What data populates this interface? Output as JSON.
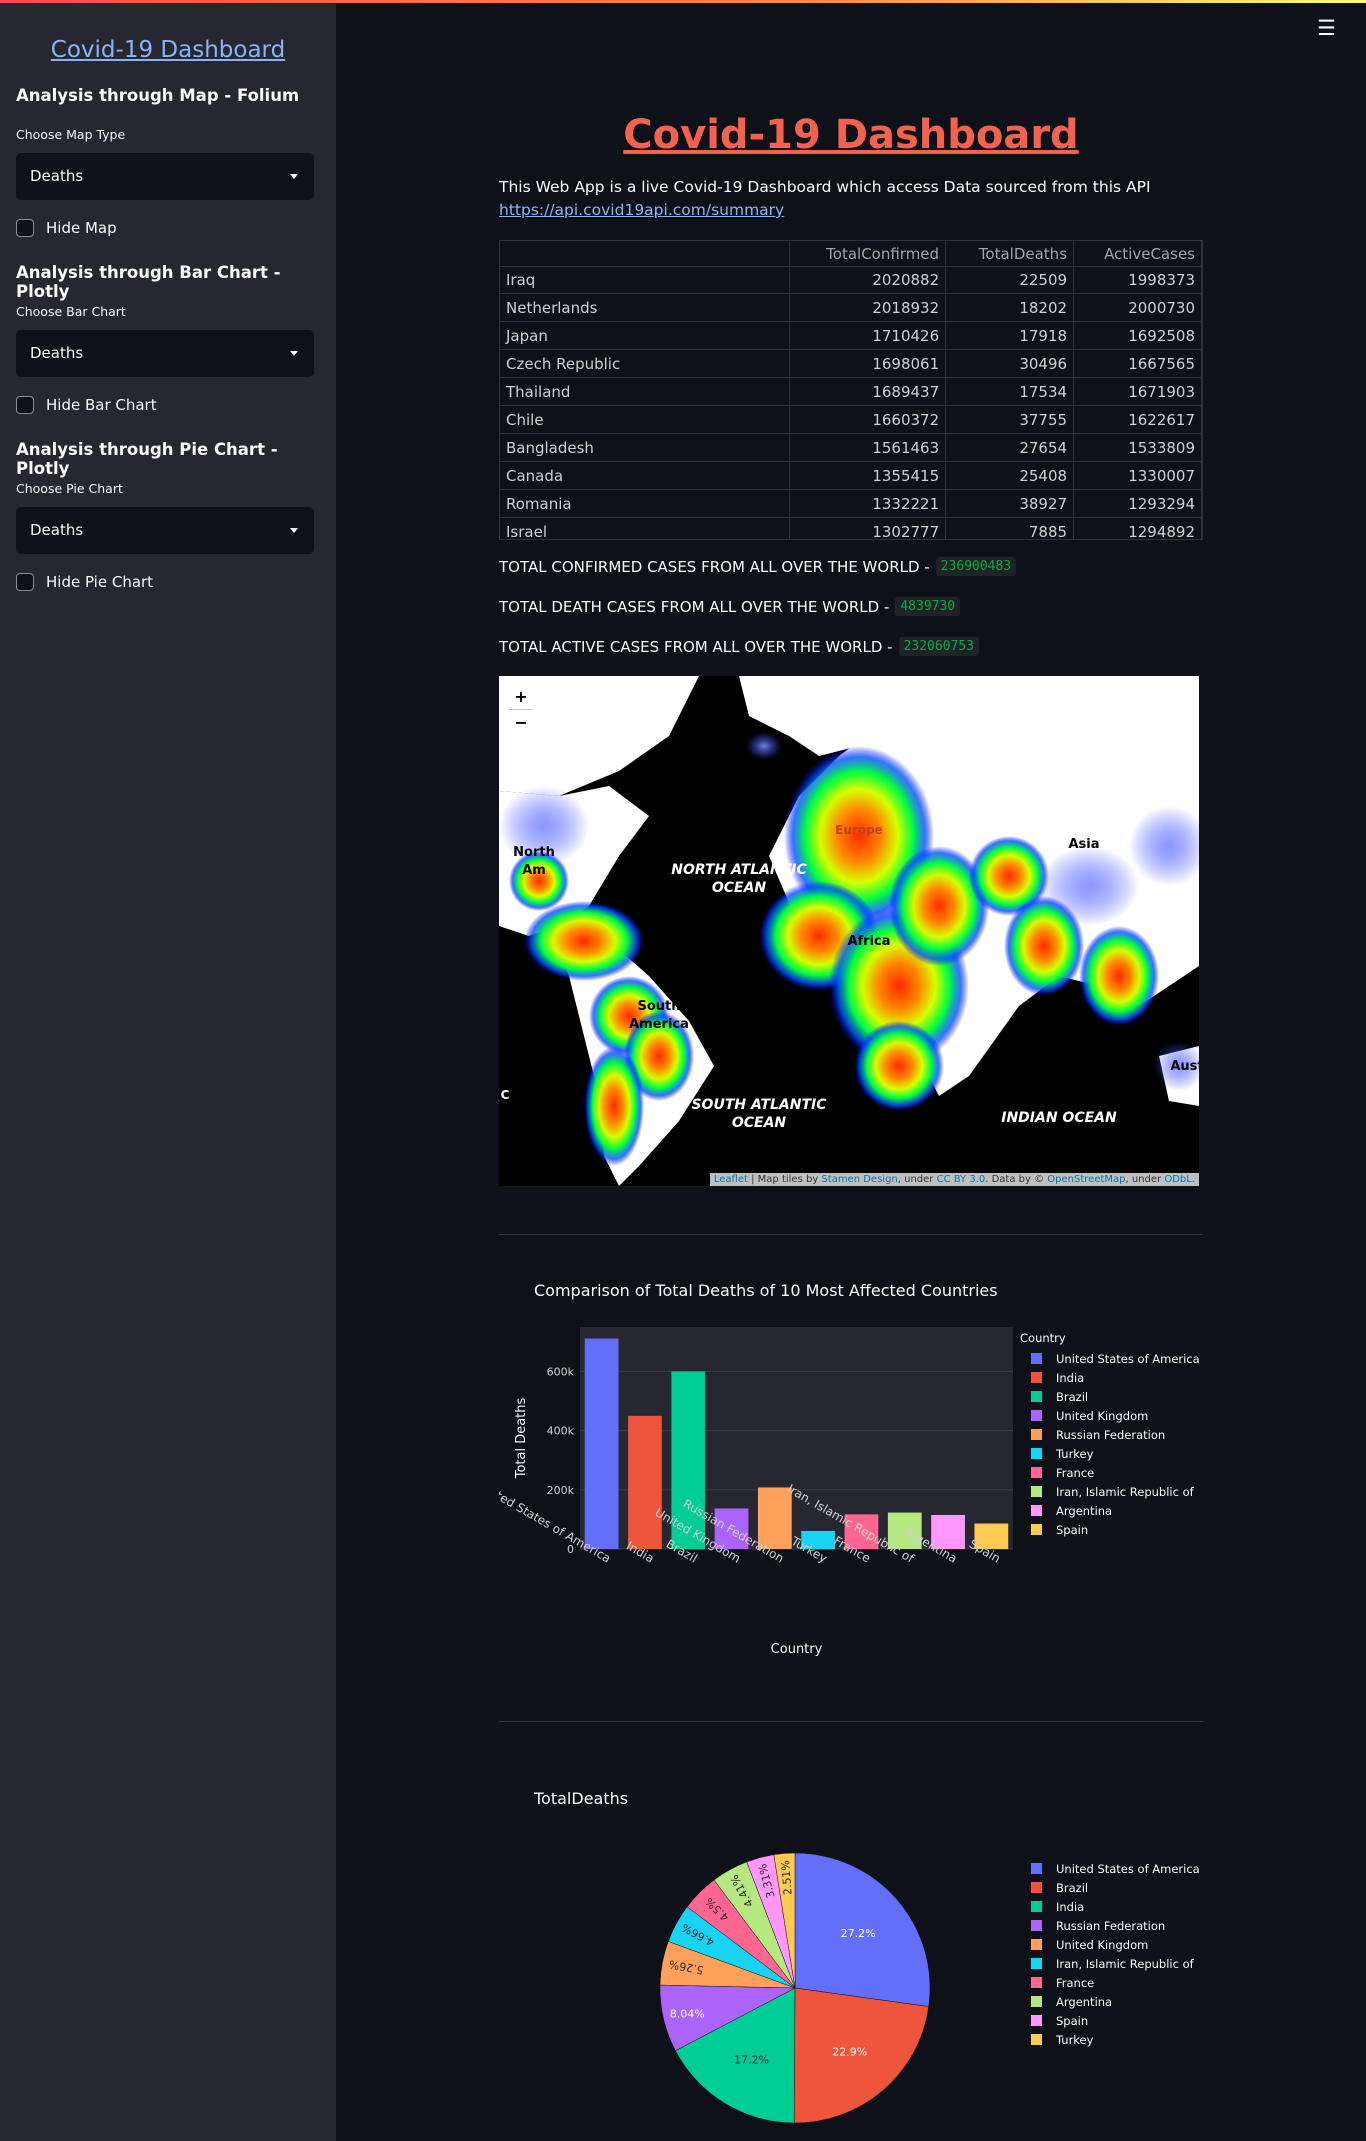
{
  "app": {
    "menu_icon": "hamburger-icon"
  },
  "sidebar": {
    "title": "Covid-19 Dashboard",
    "map_section": {
      "heading": "Analysis through Map - Folium",
      "label": "Choose Map Type",
      "value": "Deaths",
      "hide_label": "Hide Map"
    },
    "bar_section": {
      "heading": "Analysis through Bar Chart - Plotly",
      "label": "Choose Bar Chart",
      "value": "Deaths",
      "hide_label": "Hide Bar Chart"
    },
    "pie_section": {
      "heading": "Analysis through Pie Chart - Plotly",
      "label": "Choose Pie Chart",
      "value": "Deaths",
      "hide_label": "Hide Pie Chart"
    }
  },
  "main": {
    "title": "Covid-19 Dashboard",
    "intro": "This Web App is a live Covid-19 Dashboard which access Data sourced from this API",
    "api_link": "https://api.covid19api.com/summary"
  },
  "table": {
    "columns": [
      "",
      "TotalConfirmed",
      "TotalDeaths",
      "ActiveCases"
    ],
    "rows": [
      [
        "Iraq",
        "2020882",
        "22509",
        "1998373"
      ],
      [
        "Netherlands",
        "2018932",
        "18202",
        "2000730"
      ],
      [
        "Japan",
        "1710426",
        "17918",
        "1692508"
      ],
      [
        "Czech Republic",
        "1698061",
        "30496",
        "1667565"
      ],
      [
        "Thailand",
        "1689437",
        "17534",
        "1671903"
      ],
      [
        "Chile",
        "1660372",
        "37755",
        "1622617"
      ],
      [
        "Bangladesh",
        "1561463",
        "27654",
        "1533809"
      ],
      [
        "Canada",
        "1355415",
        "25408",
        "1330007"
      ],
      [
        "Romania",
        "1332221",
        "38927",
        "1293294"
      ],
      [
        "Israel",
        "1302777",
        "7885",
        "1294892"
      ]
    ]
  },
  "totals": {
    "confirmed_label": "TOTAL CONFIRMED CASES FROM ALL OVER THE WORLD -",
    "confirmed_value": "236900483",
    "deaths_label": "TOTAL DEATH CASES FROM ALL OVER THE WORLD -",
    "deaths_value": "4839730",
    "active_label": "TOTAL ACTIVE CASES FROM ALL OVER THE WORLD -",
    "active_value": "232060753"
  },
  "map": {
    "zoom_in": "+",
    "zoom_out": "−",
    "labels": {
      "north_atlantic": "NORTH ATLANTIC\nOCEAN",
      "south_atlantic": "SOUTH ATLANTIC\nOCEAN",
      "indian": "INDIAN OCEAN",
      "north_america": "North\nAm",
      "south_america": "South\nAmerica",
      "africa": "Africa",
      "asia": "Asia",
      "europe": "Europe",
      "australia": "Aust",
      "edge_c": "C"
    },
    "attribution": {
      "leaflet": "Leaflet",
      "t1": " | Map tiles by ",
      "stamen": "Stamen Design",
      "t2": ", under ",
      "ccby": "CC BY 3.0",
      "t3": ". Data by © ",
      "osm": "OpenStreetMap",
      "t4": ", under ",
      "odbl": "ODbL."
    },
    "heat_colors": [
      "#ff0000",
      "#ffff00",
      "#00ff00",
      "#0000ff"
    ]
  },
  "chart_data": [
    {
      "type": "bar",
      "title": "Comparison of Total Deaths of 10 Most Affected Countries",
      "xlabel": "Country",
      "ylabel": "Total Deaths",
      "legend_title": "Country",
      "legend_position": "right",
      "categories": [
        "United States of America",
        "India",
        "Brazil",
        "United Kingdom",
        "Russian Federation",
        "Turkey",
        "France",
        "Iran, Islamic Republic of",
        "Argentina",
        "Spain"
      ],
      "values": [
        711000,
        450000,
        600000,
        137000,
        208000,
        61000,
        117000,
        123000,
        115000,
        86000
      ],
      "colors": [
        "#636efa",
        "#ef553b",
        "#00cc96",
        "#ab63fa",
        "#ffa15a",
        "#19d3f3",
        "#ff6692",
        "#b6e880",
        "#ff97ff",
        "#fecb52"
      ],
      "yticks": [
        0,
        200000,
        400000,
        600000
      ],
      "ytick_labels": [
        "0",
        "200k",
        "400k",
        "600k"
      ],
      "ylim": [
        0,
        750000
      ],
      "grid": true
    },
    {
      "type": "pie",
      "title": "TotalDeaths",
      "legend_position": "right",
      "labels": [
        "United States of America",
        "Brazil",
        "India",
        "Russian Federation",
        "United Kingdom",
        "Iran, Islamic Republic of",
        "France",
        "Argentina",
        "Spain",
        "Turkey"
      ],
      "values": [
        27.2,
        22.9,
        17.2,
        8.04,
        5.26,
        4.66,
        4.5,
        4.41,
        3.31,
        2.51
      ],
      "value_labels": [
        "27.2%",
        "22.9%",
        "17.2%",
        "8.04%",
        "5.26%",
        "4.66%",
        "4.5%",
        "4.41%",
        "3.31%",
        "2.51%"
      ],
      "colors": [
        "#636efa",
        "#ef553b",
        "#00cc96",
        "#ab63fa",
        "#ffa15a",
        "#19d3f3",
        "#ff6692",
        "#b6e880",
        "#ff97ff",
        "#fecb52"
      ]
    }
  ]
}
